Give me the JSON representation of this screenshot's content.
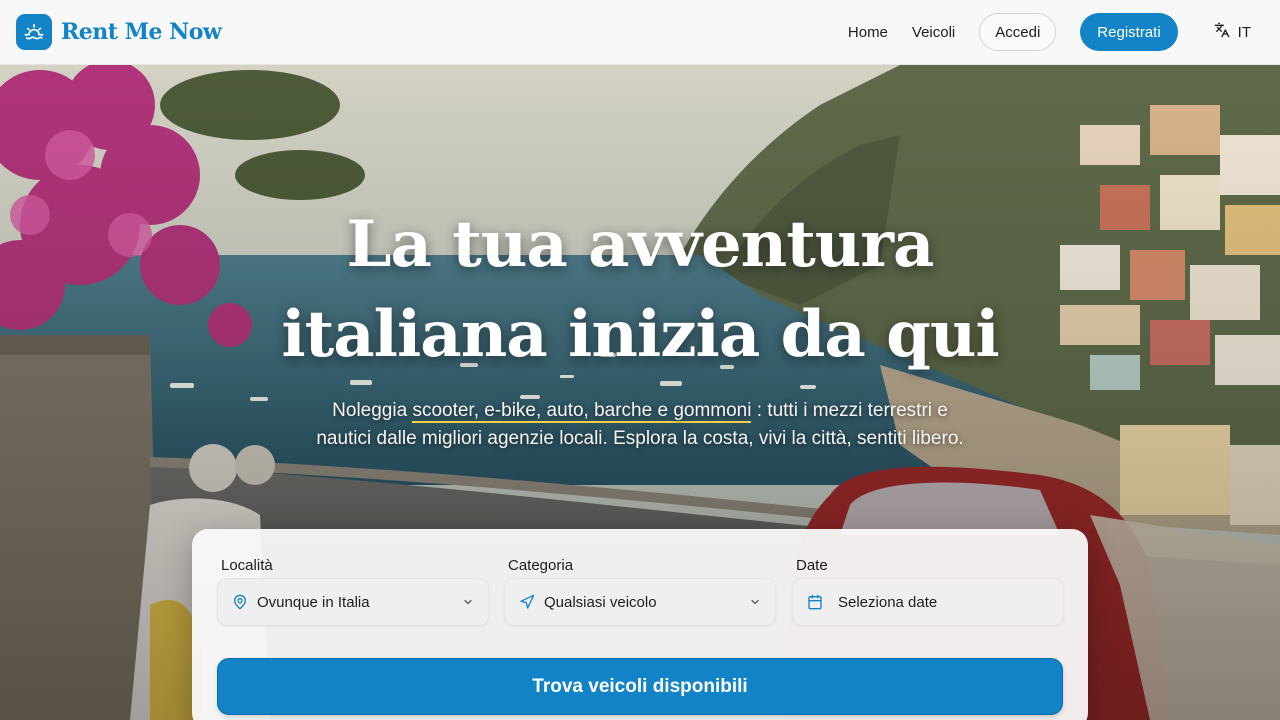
{
  "brand": {
    "name": "Rent Me Now",
    "color": "#1283c6"
  },
  "nav": {
    "links": [
      "Home",
      "Veicoli"
    ],
    "login_label": "Accedi",
    "register_label": "Registrati",
    "language": "IT",
    "language_icon": "translate-icon"
  },
  "hero": {
    "title_line1": "La tua avventura",
    "title_line2": "italiana inizia da qui",
    "subtitle_before": "Noleggia ",
    "subtitle_highlight": "scooter, e-bike, auto, barche e gommoni",
    "subtitle_after": " : tutti i mezzi terrestri e nautici dalle migliori agenzie locali. Esplora la costa, vivi la città, sentiti libero.",
    "highlight_color": "#f2d24a"
  },
  "search": {
    "location": {
      "label": "Località",
      "value": "Ovunque in Italia",
      "icon": "map-pin-icon"
    },
    "category": {
      "label": "Categoria",
      "value": "Qualsiasi veicolo",
      "icon": "navigation-arrow-icon"
    },
    "dates": {
      "label": "Date",
      "value": "Seleziona date",
      "icon": "calendar-icon"
    },
    "submit_label": "Trova veicoli disponibili"
  }
}
